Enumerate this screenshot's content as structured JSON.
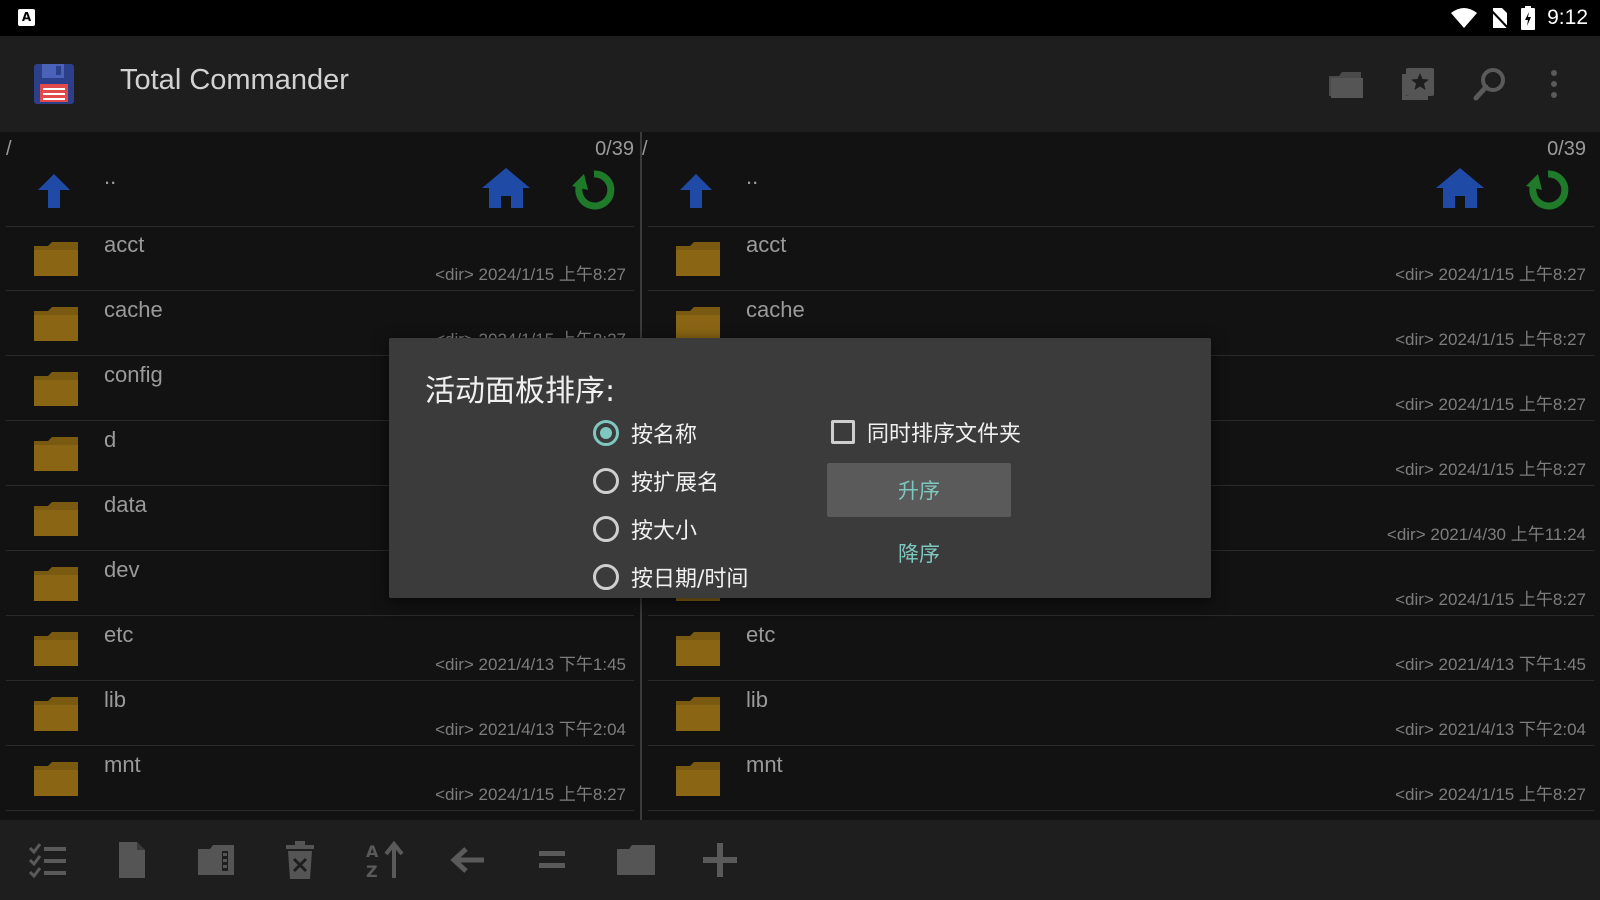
{
  "status_bar": {
    "time": "9:12",
    "notification_icon": "A"
  },
  "app_bar": {
    "title": "Total Commander",
    "actions": [
      "folder-icon",
      "bookmark-star-icon",
      "search-icon",
      "more-vert-icon"
    ]
  },
  "left_panel": {
    "path": "/",
    "count": "0/39",
    "parent_label": "..",
    "rows": [
      {
        "name": "acct",
        "meta": "<dir>  2024/1/15  上午8:27"
      },
      {
        "name": "cache",
        "meta": "<dir>  2024/1/15  上午8:27"
      },
      {
        "name": "config",
        "meta": ""
      },
      {
        "name": "d",
        "meta": ""
      },
      {
        "name": "data",
        "meta": ""
      },
      {
        "name": "dev",
        "meta": ""
      },
      {
        "name": "etc",
        "meta": "<dir>  2021/4/13  下午1:45"
      },
      {
        "name": "lib",
        "meta": "<dir>  2021/4/13  下午2:04"
      },
      {
        "name": "mnt",
        "meta": "<dir>  2024/1/15  上午8:27"
      }
    ]
  },
  "right_panel": {
    "path": "/",
    "count": "0/39",
    "parent_label": "..",
    "rows": [
      {
        "name": "acct",
        "meta": "<dir>  2024/1/15  上午8:27"
      },
      {
        "name": "cache",
        "meta": "<dir>  2024/1/15  上午8:27"
      },
      {
        "name": "",
        "meta": "<dir>  2024/1/15  上午8:27"
      },
      {
        "name": "",
        "meta": "<dir>  2024/1/15  上午8:27"
      },
      {
        "name": "",
        "meta": "<dir>  2021/4/30  上午11:24"
      },
      {
        "name": "",
        "meta": "<dir>  2024/1/15  上午8:27"
      },
      {
        "name": "etc",
        "meta": "<dir>  2021/4/13  下午1:45"
      },
      {
        "name": "lib",
        "meta": "<dir>  2021/4/13  下午2:04"
      },
      {
        "name": "mnt",
        "meta": "<dir>  2024/1/15  上午8:27"
      }
    ]
  },
  "dialog": {
    "title": "活动面板排序:",
    "options": [
      {
        "label": "按名称",
        "checked": true
      },
      {
        "label": "按扩展名",
        "checked": false
      },
      {
        "label": "按大小",
        "checked": false
      },
      {
        "label": "按日期/时间",
        "checked": false
      }
    ],
    "sort_folders_label": "同时排序文件夹",
    "sort_folders_checked": false,
    "ascending_label": "升序",
    "descending_label": "降序"
  },
  "toolbar": {
    "buttons": [
      "select-icon",
      "file-icon",
      "zip-icon",
      "delete-icon",
      "sort-icon",
      "back-icon",
      "equal-icon",
      "folder-icon",
      "add-icon"
    ]
  },
  "colors": {
    "accent": "#7ec8c0",
    "folder": "#7a5a10",
    "home": "#1f4aa6",
    "refresh": "#1f7a2a"
  }
}
